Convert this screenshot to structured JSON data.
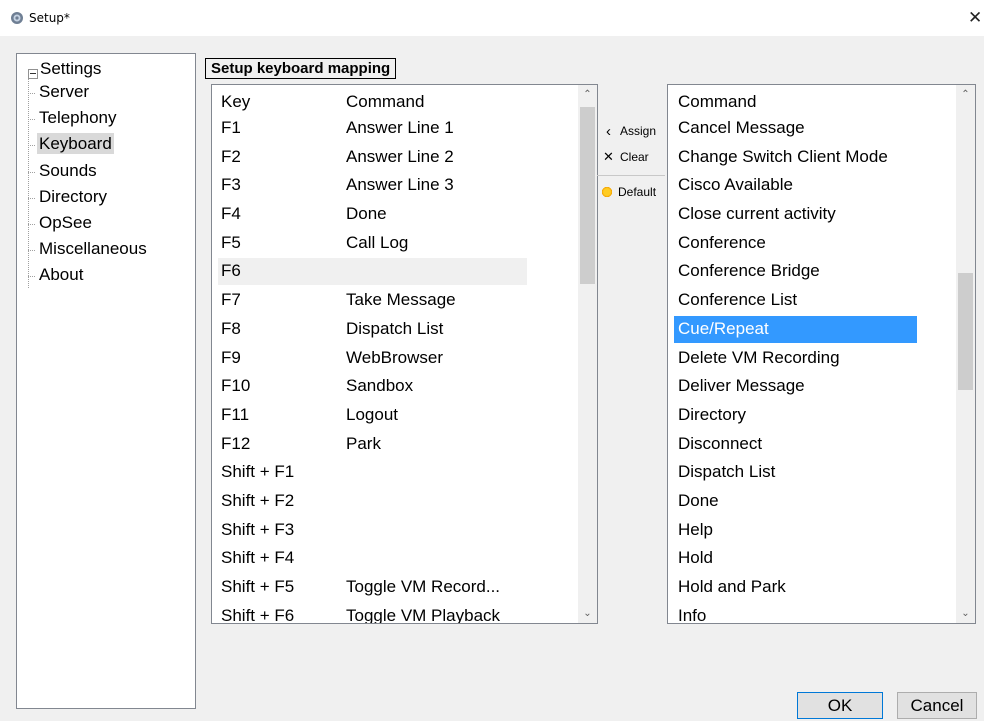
{
  "window": {
    "title": "Setup*",
    "icon": "gear-icon",
    "close_icon": "close-icon"
  },
  "tree": {
    "root_label": "Settings",
    "selected": "Keyboard",
    "items": [
      "Server",
      "Telephony",
      "Keyboard",
      "Sounds",
      "Directory",
      "OpSee",
      "Miscellaneous",
      "About"
    ]
  },
  "group_label": "Setup keyboard mapping",
  "key_list": {
    "headers": {
      "key": "Key",
      "command": "Command"
    },
    "selected_key": "F6",
    "rows": [
      {
        "key": "F1",
        "command": "Answer Line 1"
      },
      {
        "key": "F2",
        "command": "Answer Line 2"
      },
      {
        "key": "F3",
        "command": "Answer Line 3"
      },
      {
        "key": "F4",
        "command": "Done"
      },
      {
        "key": "F5",
        "command": "Call Log"
      },
      {
        "key": "F6",
        "command": ""
      },
      {
        "key": "F7",
        "command": "Take Message"
      },
      {
        "key": "F8",
        "command": "Dispatch List"
      },
      {
        "key": "F9",
        "command": "WebBrowser"
      },
      {
        "key": "F10",
        "command": "Sandbox"
      },
      {
        "key": "F11",
        "command": "Logout"
      },
      {
        "key": "F12",
        "command": "Park"
      },
      {
        "key": "Shift + F1",
        "command": ""
      },
      {
        "key": "Shift + F2",
        "command": ""
      },
      {
        "key": "Shift + F3",
        "command": ""
      },
      {
        "key": "Shift + F4",
        "command": ""
      },
      {
        "key": "Shift + F5",
        "command": "Toggle VM Record..."
      },
      {
        "key": "Shift + F6",
        "command": "Toggle VM Playback"
      }
    ]
  },
  "actions": {
    "assign": {
      "label": "Assign",
      "icon": "chevron-left-icon"
    },
    "clear": {
      "label": "Clear",
      "icon": "close-icon"
    },
    "default": {
      "label": "Default",
      "icon": "sun-icon"
    }
  },
  "command_list": {
    "header": "Command",
    "selected": "Cue/Repeat",
    "items": [
      "Cancel Message",
      "Change Switch Client Mode",
      "Cisco Available",
      "Close current activity",
      "Conference",
      "Conference Bridge",
      "Conference List",
      "Cue/Repeat",
      "Delete VM Recording",
      "Deliver Message",
      "Directory",
      "Disconnect",
      "Dispatch List",
      "Done",
      "Help",
      "Hold",
      "Hold and Park",
      "Info"
    ]
  },
  "buttons": {
    "ok": "OK",
    "cancel": "Cancel"
  },
  "colors": {
    "selection": "#3399ff",
    "default_button_border": "#0078d7"
  }
}
